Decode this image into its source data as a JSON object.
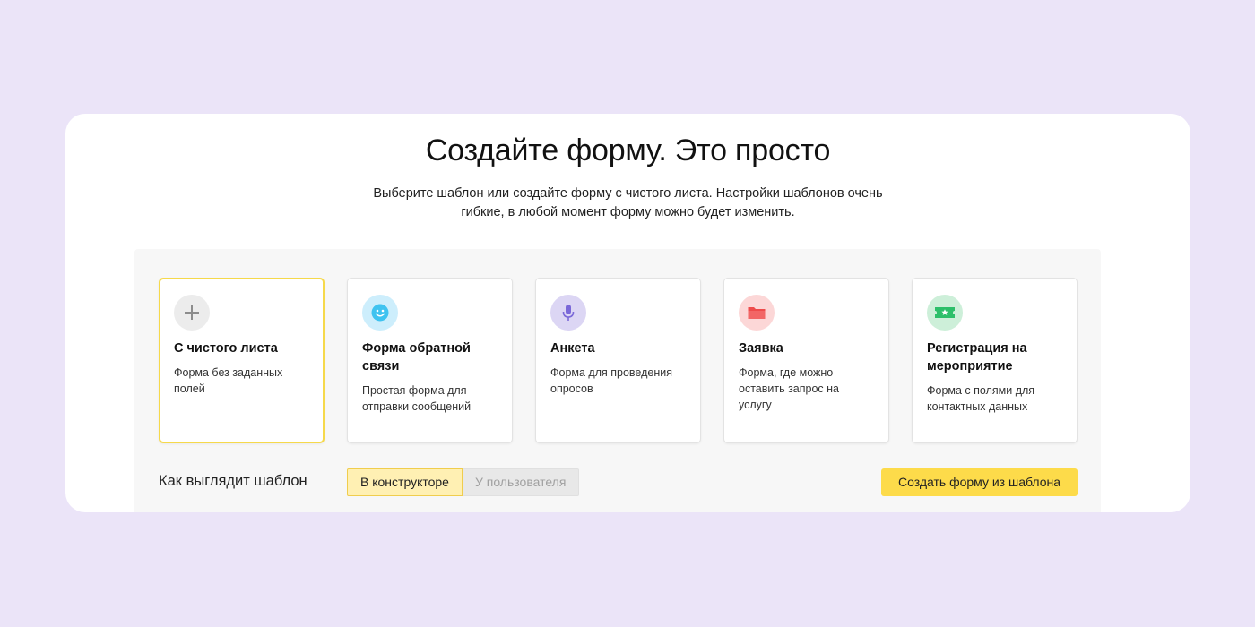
{
  "page": {
    "title": "Создайте форму. Это просто",
    "subtitle": "Выберите шаблон или создайте форму с чистого листа. Настройки шаблонов очень гибкие, в любой момент форму можно будет изменить."
  },
  "templates": [
    {
      "name": "С чистого листа",
      "description": "Форма без заданных полей",
      "icon": "plus-icon",
      "icon_bg": "#ececec",
      "selected": true
    },
    {
      "name": "Форма обратной связи",
      "description": "Простая форма для отправки сообщений",
      "icon": "smiley-icon",
      "icon_bg": "#cdeefc",
      "selected": false
    },
    {
      "name": "Анкета",
      "description": "Форма для проведения опросов",
      "icon": "microphone-icon",
      "icon_bg": "#dcd6f4",
      "selected": false
    },
    {
      "name": "Заявка",
      "description": "Форма, где можно оставить запрос на услугу",
      "icon": "folder-icon",
      "icon_bg": "#fcd7d7",
      "selected": false
    },
    {
      "name": "Регистрация на мероприятие",
      "description": "Форма с полями для контактных данных",
      "icon": "ticket-icon",
      "icon_bg": "#cdefd9",
      "selected": false
    }
  ],
  "preview": {
    "label": "Как выглядит шаблон",
    "options": [
      "В конструкторе",
      "У пользователя"
    ],
    "active": "В конструкторе"
  },
  "actions": {
    "create_label": "Создать форму из шаблона"
  },
  "colors": {
    "page_bg": "#ebe4f8",
    "accent_yellow": "#fddb4a",
    "selected_border": "#f6d94b"
  }
}
